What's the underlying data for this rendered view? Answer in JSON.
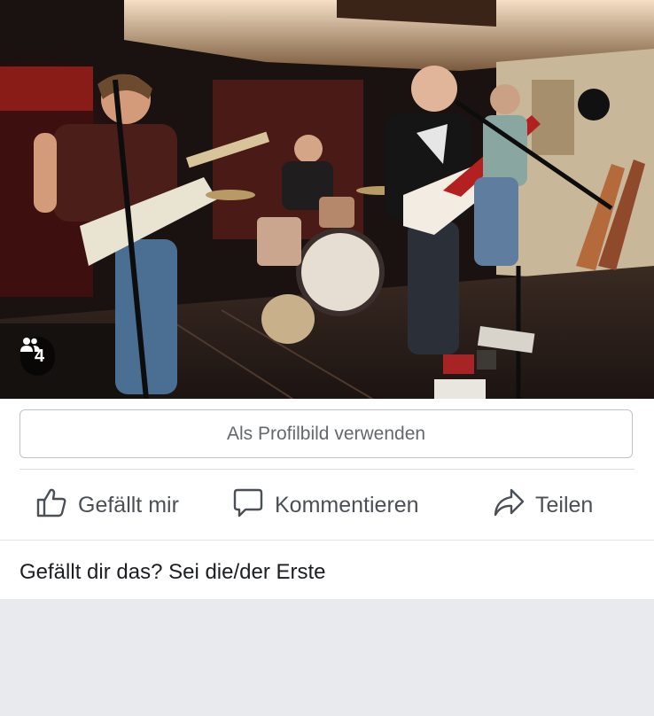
{
  "photo": {
    "description_icon": "people-icon",
    "tag_count": "4"
  },
  "profile_button": {
    "label": "Als Profilbild verwenden"
  },
  "actions": {
    "like": {
      "label": "Gefällt mir",
      "icon": "thumbs-up-icon"
    },
    "comment": {
      "label": "Kommentieren",
      "icon": "speech-bubble-icon"
    },
    "share": {
      "label": "Teilen",
      "icon": "share-arrow-icon"
    }
  },
  "reactions": {
    "summary": "Gefällt dir das? Sei die/der Erste"
  },
  "colors": {
    "button_border": "#bec3c9",
    "button_text": "#65686c",
    "action_text": "#4b4f56",
    "page_background": "#e9eaee"
  }
}
